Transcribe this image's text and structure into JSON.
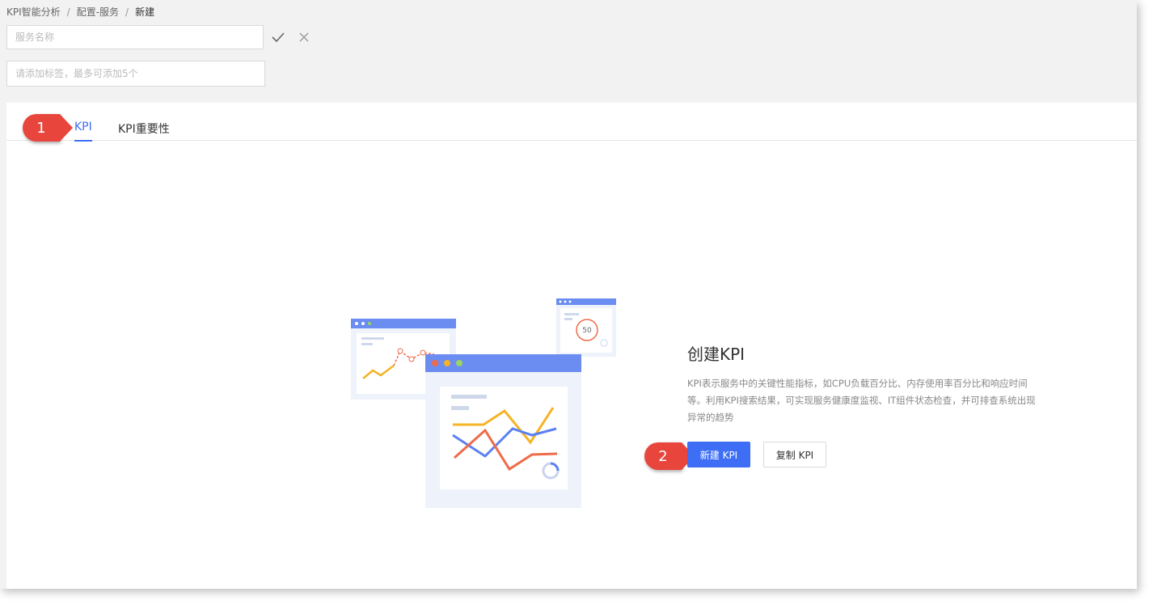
{
  "breadcrumb": {
    "items": [
      "KPI智能分析",
      "配置-服务",
      "新建"
    ],
    "separator": "/"
  },
  "form": {
    "name_placeholder": "服务名称",
    "tag_placeholder": "请添加标签，最多可添加5个"
  },
  "tabs": [
    {
      "label": "KPI",
      "active": true
    },
    {
      "label": "KPI重要性",
      "active": false
    }
  ],
  "callouts": [
    "1",
    "2"
  ],
  "empty_state": {
    "title": "创建KPI",
    "description": "KPI表示服务中的关键性能指标，如CPU负载百分比、内存使用率百分比和响应时间等。利用KPI搜索结果，可实现服务健康度监视、IT组件状态检查，并可排查系统出现异常的趋势",
    "primary_button": "新建 KPI",
    "secondary_button": "复制 KPI",
    "gauge_value": "50"
  },
  "colors": {
    "accent": "#3d6ef5",
    "callout": "#e8453c",
    "illus_header": "#6b8cf0"
  }
}
